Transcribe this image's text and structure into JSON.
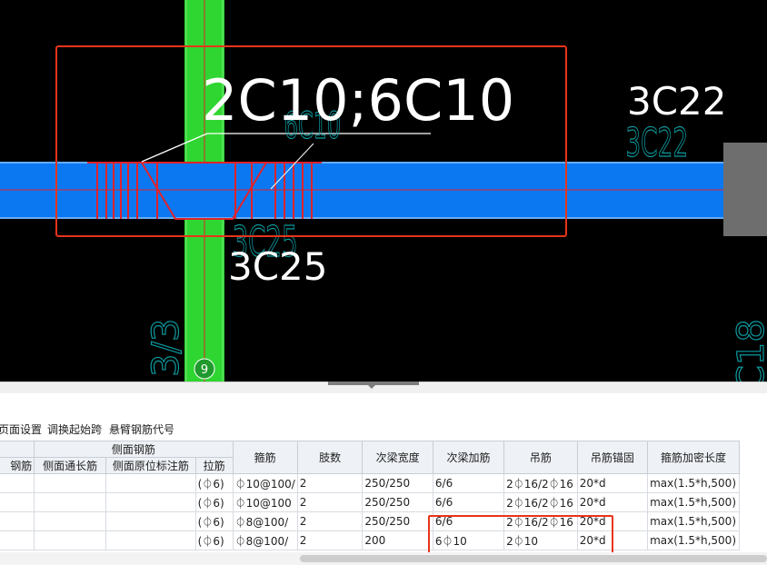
{
  "drawing": {
    "top_label": "2C10;6C10",
    "top_label_ghost": "6C10",
    "right_label": "3C22",
    "right_label_ghost": "3C22",
    "bottom_label": "3C25",
    "bottom_label_ghost": "3C25",
    "left_ghost": "3/3",
    "right_edge_ghost": "C18",
    "axis_number": "9",
    "colors": {
      "canvas": "#000000",
      "beam": "#0b78f2",
      "column": "#2fd631",
      "rebar": "#e0222b",
      "ghost_text": "#0a9a9e",
      "highlight_box": "#e8341c"
    }
  },
  "toolbar": {
    "page_settings": "页面设置",
    "adjust_start_span": "调换起始跨",
    "cantilever_code": "悬臂钢筋代号"
  },
  "table": {
    "group_header": "侧面钢筋",
    "columns": {
      "col0": "钢筋",
      "side_through": "侧面通长筋",
      "side_original": "侧面原位标注筋",
      "tie": "拉筋",
      "stirrup": "箍筋",
      "legs": "肢数",
      "sec_beam_width": "次梁宽度",
      "sec_beam_extra": "次梁加筋",
      "hanger": "吊筋",
      "hanger_anchor": "吊筋锚固",
      "stirrup_dense_len": "箍筋加密长度"
    },
    "rows": [
      {
        "col0": "",
        "side_through": "",
        "side_original": "",
        "tie": "(⏀6)",
        "stirrup": "⏀10@100/",
        "legs": "2",
        "sec_beam_width": "250/250",
        "sec_beam_extra": "6/6",
        "hanger": "2⏀16/2⏀16",
        "hanger_anchor": "20*d",
        "stirrup_dense_len": "max(1.5*h,500)"
      },
      {
        "col0": "",
        "side_through": "",
        "side_original": "",
        "tie": "(⏀6)",
        "stirrup": "⏀10@100",
        "legs": "2",
        "sec_beam_width": "250/250",
        "sec_beam_extra": "6/6",
        "hanger": "2⏀16/2⏀16",
        "hanger_anchor": "20*d",
        "stirrup_dense_len": "max(1.5*h,500)"
      },
      {
        "col0": "",
        "side_through": "",
        "side_original": "",
        "tie": "(⏀6)",
        "stirrup": "⏀8@100/",
        "legs": "2",
        "sec_beam_width": "250/250",
        "sec_beam_extra": "6/6",
        "hanger": "2⏀16/2⏀16",
        "hanger_anchor": "20*d",
        "stirrup_dense_len": "max(1.5*h,500)"
      },
      {
        "col0": "",
        "side_through": "",
        "side_original": "",
        "tie": "(⏀6)",
        "stirrup": "⏀8@100/",
        "legs": "2",
        "sec_beam_width": "200",
        "sec_beam_extra": "6⏀10",
        "hanger": "2⏀10",
        "hanger_anchor": "20*d",
        "stirrup_dense_len": "max(1.5*h,500)"
      }
    ]
  }
}
